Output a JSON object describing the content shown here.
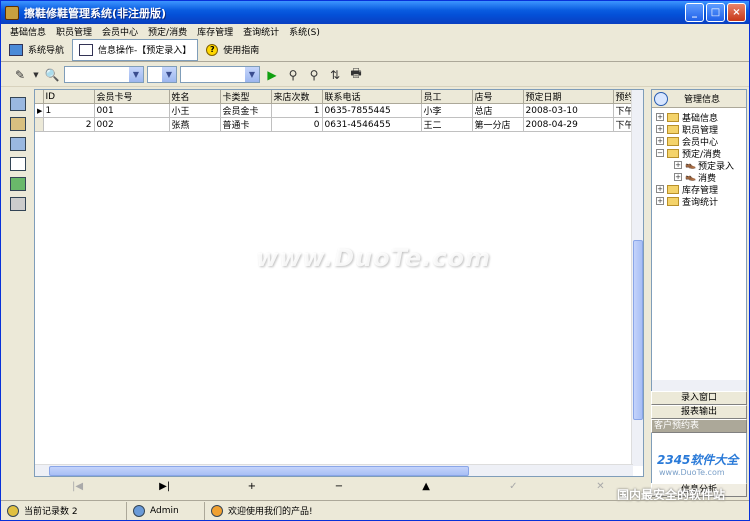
{
  "window": {
    "title": "擦鞋修鞋管理系统(非注册版)",
    "buttons": [
      "_",
      "□",
      "×"
    ]
  },
  "menu": [
    "基础信息",
    "职员管理",
    "会员中心",
    "预定/消费",
    "库存管理",
    "查询统计",
    "系统(S)"
  ],
  "tabs": [
    {
      "label": "系统导航"
    },
    {
      "label": "信息操作-【预定录入】"
    },
    {
      "label": "使用指南"
    }
  ],
  "grid": {
    "columns": [
      "ID",
      "会员卡号",
      "姓名",
      "卡类型",
      "来店次数",
      "联系电话",
      "员工",
      "店号",
      "预定日期",
      "预约"
    ],
    "rows": [
      [
        "1",
        "001",
        "小王",
        "会员金卡",
        "1",
        "0635-7855445",
        "小李",
        "总店",
        "2008-03-10",
        "下午"
      ],
      [
        "2",
        "002",
        "张燕",
        "普通卡",
        "0",
        "0631-4546455",
        "王二",
        "第一分店",
        "2008-04-29",
        "下午"
      ]
    ]
  },
  "nav": [
    "|◀",
    "▶|",
    "+",
    "−",
    "▲",
    "✓",
    "✕"
  ],
  "tree": {
    "header": "管理信息",
    "items": [
      {
        "label": "基础信息",
        "expand": "+",
        "level": 0
      },
      {
        "label": "职员管理",
        "expand": "+",
        "level": 0
      },
      {
        "label": "会员中心",
        "expand": "+",
        "level": 0
      },
      {
        "label": "预定/消费",
        "expand": "−",
        "level": 0
      },
      {
        "label": "预定录入",
        "expand": "+",
        "level": 1
      },
      {
        "label": "消费",
        "expand": "+",
        "level": 1
      },
      {
        "label": "库存管理",
        "expand": "+",
        "level": 0
      },
      {
        "label": "查询统计",
        "expand": "+",
        "level": 0
      }
    ]
  },
  "panel_buttons": [
    "录入窗口",
    "报表输出",
    "客户预约表"
  ],
  "panel_footer": "信息分析",
  "status": {
    "records": "当前记录数 2",
    "user": "Admin",
    "welcome": "欢迎使用我们的产品!"
  },
  "watermark": {
    "main": "www.DuoTe.com",
    "brand": "2345软件大全",
    "url": "www.DuoTe.com",
    "caption": "国内最安全的软件站"
  }
}
